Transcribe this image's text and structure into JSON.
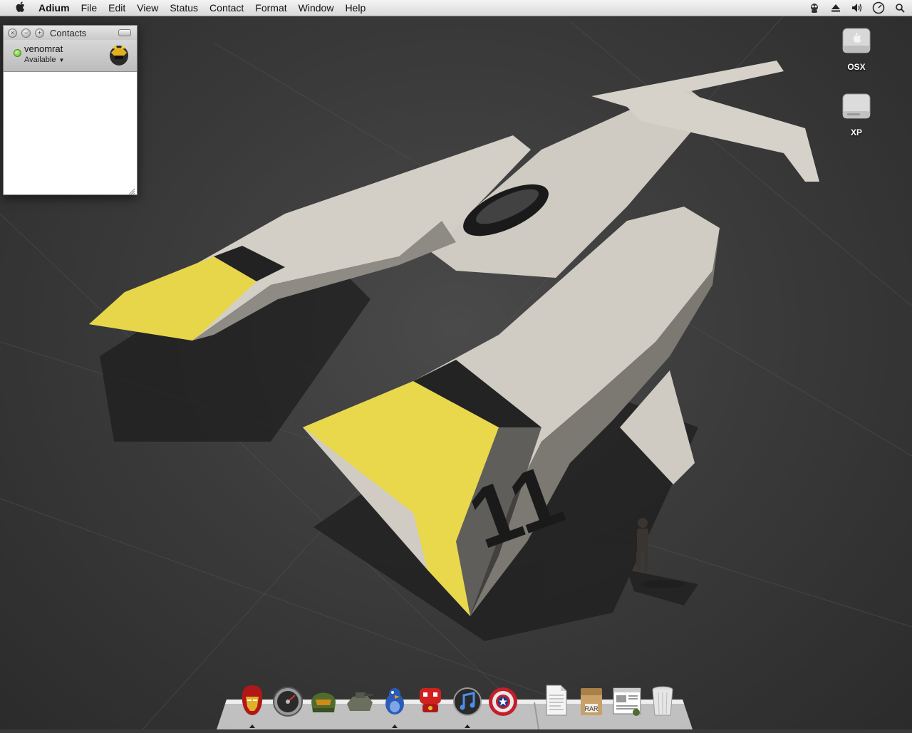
{
  "menubar": {
    "app_name": "Adium",
    "items": [
      "File",
      "Edit",
      "View",
      "Status",
      "Contact",
      "Format",
      "Window",
      "Help"
    ],
    "status_icons": [
      "adium-duck-icon",
      "eject-icon",
      "volume-icon",
      "clock-icon",
      "spotlight-icon"
    ]
  },
  "contacts_window": {
    "title": "Contacts",
    "user": {
      "name": "venomrat",
      "status": "Available",
      "status_color": "#56b51a"
    }
  },
  "desktop_icons": [
    {
      "label": "OSX",
      "icon": "hard-drive-icon"
    },
    {
      "label": "XP",
      "icon": "hard-drive-icon"
    }
  ],
  "dock": {
    "apps": [
      "iron-man-icon",
      "speedometer-icon",
      "master-chief-icon",
      "tank-icon",
      "blue-bird-icon",
      "red-robot-icon",
      "itunes-icon",
      "captain-america-shield-icon"
    ],
    "docs": [
      "text-document-icon",
      "rar-archive-icon",
      "document-viewer-icon",
      "trash-icon"
    ],
    "rar_label": "RAR"
  },
  "wallpaper": {
    "ship_number": "11"
  }
}
